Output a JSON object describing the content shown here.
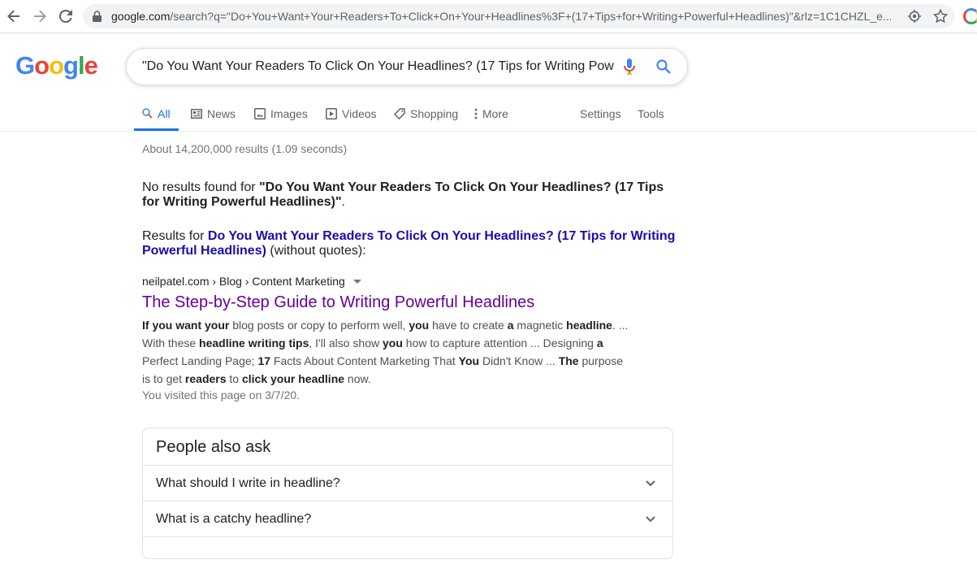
{
  "browser": {
    "url_host": "google.com",
    "url_rest": "/search?q=\"Do+You+Want+Your+Readers+To+Click+On+Your+Headlines%3F+(17+Tips+for+Writing+Powerful+Headlines)\"&rlz=1C1CHZL_e..."
  },
  "google": {
    "logo_letters": [
      "G",
      "o",
      "o",
      "g",
      "l",
      "e"
    ],
    "query": "\"Do You Want Your Readers To Click On Your Headlines? (17 Tips for Writing Pow"
  },
  "tabs": [
    {
      "label": "All",
      "icon": "search-icon"
    },
    {
      "label": "News",
      "icon": "news-icon"
    },
    {
      "label": "Images",
      "icon": "image-icon"
    },
    {
      "label": "Videos",
      "icon": "video-icon"
    },
    {
      "label": "Shopping",
      "icon": "tag-icon"
    },
    {
      "label": "More",
      "icon": "more-dots-icon"
    }
  ],
  "tools": {
    "settings": "Settings",
    "tools": "Tools"
  },
  "stats": "About 14,200,000 results (1.09 seconds)",
  "notice": {
    "prefix": "No results found for ",
    "query": "\"Do You Want Your Readers To Click On Your Headlines? (17 Tips for Writing Powerful Headlines)\"",
    "suffix": "."
  },
  "results_for": {
    "prefix": "Results for ",
    "link": "Do You Want Your Readers To Click On Your Headlines? (17 Tips for Writing Powerful Headlines)",
    "suffix": " (without quotes):"
  },
  "result": {
    "cite": "neilpatel.com › Blog › Content Marketing",
    "title": "The Step-by-Step Guide to Writing Powerful Headlines",
    "visited": "You visited this page on 3/7/20."
  },
  "paa": {
    "heading": "People also ask",
    "questions": [
      "What should I write in headline?",
      "What is a catchy headline?"
    ]
  },
  "colors": {
    "link": "#1a0dab",
    "visited": "#660099",
    "accent": "#1a73e8"
  }
}
